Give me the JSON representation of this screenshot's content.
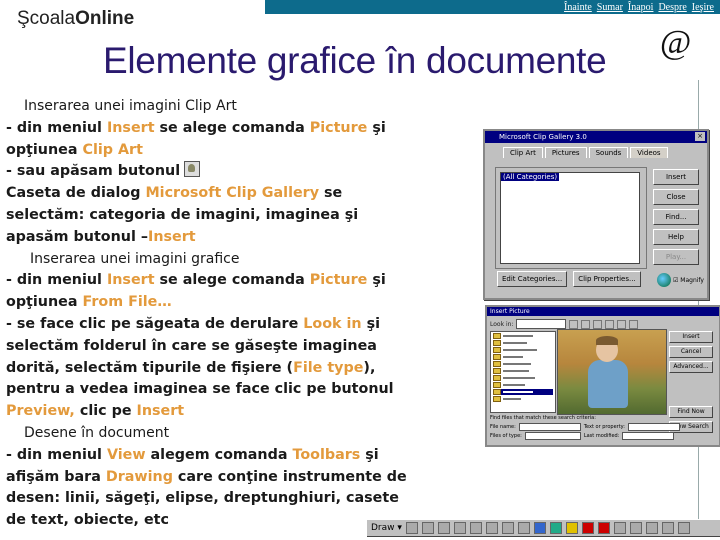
{
  "nav": {
    "links": [
      "Înainte",
      "Sumar",
      "Înapoi",
      "Despre",
      "Ieşire"
    ]
  },
  "logo": {
    "part1": "Şcoala",
    "part2": "Online"
  },
  "title": "Elemente grafice în documente",
  "at_symbol": "@",
  "colors": {
    "title": "#2a1a6e",
    "highlight": "#e39a3c",
    "topbar": "#0d6b8c"
  },
  "content": {
    "s1_heading": "Inserarea unei imagini Clip Art",
    "s1_l1": [
      "- din meniul ",
      "Insert",
      " se alege comanda ",
      "Picture",
      " şi"
    ],
    "s1_l2": [
      "opţiunea ",
      "Clip Art"
    ],
    "s1_l3": "- sau apăsam butonul",
    "s1_l4": [
      "Caseta de dialog ",
      "Microsoft Clip Gallery",
      " se"
    ],
    "s1_l5": "selectăm: categoria de imagini, imaginea şi",
    "s1_l6": [
      "apasăm  butonul –",
      "Insert"
    ],
    "s2_heading": "Inserarea unei imagini grafice",
    "s2_l1": [
      " - din meniul ",
      "Insert",
      " se alege comanda ",
      "Picture",
      " şi"
    ],
    "s2_l2": [
      "opţiunea ",
      "From File…"
    ],
    "s2_l3": [
      "- se face clic pe săgeata de derulare ",
      "Look in",
      "  şi"
    ],
    "s2_l4": "selectăm folderul în care se găseşte imaginea",
    "s2_l5": [
      "dorită,  selectăm tipurile de fişiere (",
      "File type",
      "),"
    ],
    "s2_l6": "pentru a vedea imaginea se face clic pe butonul",
    "s2_l7": [
      "Preview,",
      "  clic pe ",
      "Insert"
    ],
    "s3_heading": "Desene în document",
    "s3_l1": [
      "- din meniul ",
      "View",
      " alegem comanda ",
      "Toolbars",
      "  şi"
    ],
    "s3_l2": [
      "afişăm bara ",
      "Drawing",
      " care conţine instrumente de"
    ],
    "s3_l3": "desen: linii, săgeţi, elipse, dreptunghiuri, casete",
    "s3_l4": "de text, obiecte, etc"
  },
  "clip_dialog": {
    "title": "Microsoft Clip Gallery 3.0",
    "tabs": [
      "Clip Art",
      "Pictures",
      "Sounds",
      "Videos"
    ],
    "list_selected": "(All Categories)",
    "buttons": [
      "Insert",
      "Close",
      "Find...",
      "Help",
      "Play..."
    ],
    "bottom_buttons": [
      "Edit Categories...",
      "Clip Properties..."
    ],
    "checkbox": "Magnify"
  },
  "picture_dialog": {
    "title": "Insert Picture",
    "look_in": "Look in:",
    "buttons": [
      "Insert",
      "Cancel",
      "Advanced...",
      "Find Now",
      "New Search"
    ],
    "find_label": "Find files that match these search criteria:",
    "file_name": "File name:",
    "files_of_type": "Files of type:",
    "text_property": "Text or property:",
    "last_modified": "Last modified:"
  },
  "drawbar": {
    "label": "Draw ▾"
  }
}
